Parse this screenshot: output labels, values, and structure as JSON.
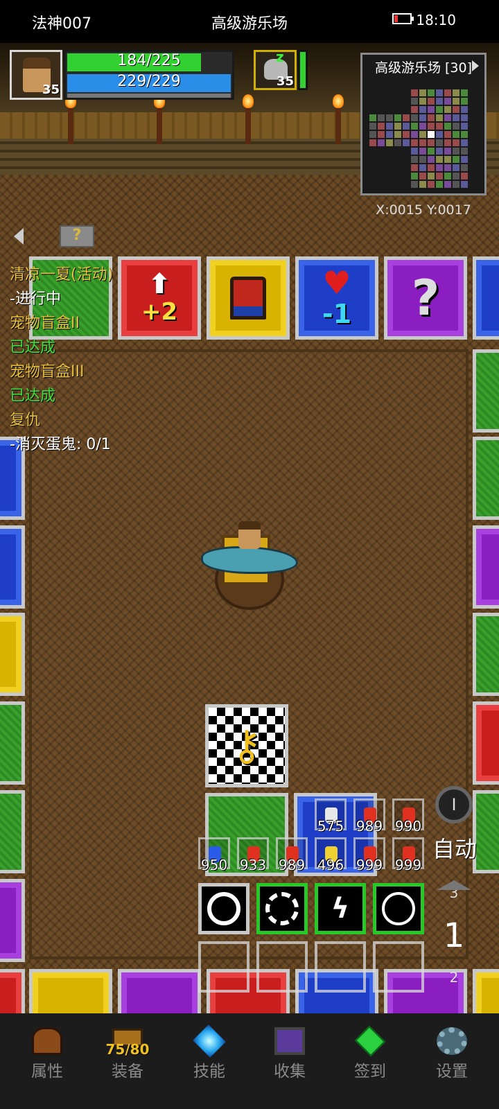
{
  "statusbar": {
    "player_name": "法神007",
    "location": "高级游乐场",
    "time": "18:10"
  },
  "hud": {
    "player_level": "35",
    "hp_text": "184/225",
    "hp_fraction": 0.818,
    "mp_text": "229/229",
    "mp_fraction": 1.0,
    "pet_level": "35",
    "pet_status": "z"
  },
  "minimap": {
    "title": "高级游乐场 [30]",
    "coords": "X:0015  Y:0017"
  },
  "quests": {
    "help_label": "?",
    "lines": [
      {
        "text": "清凉一夏(活动)",
        "style": "title"
      },
      {
        "text": "-进行中",
        "style": "white"
      },
      {
        "text": "宠物盲盒II",
        "style": "title"
      },
      {
        "text": "已达成",
        "style": "green"
      },
      {
        "text": "宠物盲盒III",
        "style": "title"
      },
      {
        "text": "已达成",
        "style": "green"
      },
      {
        "text": "复仇",
        "style": "title"
      },
      {
        "text": "-消灭蛋鬼: 0/1",
        "style": "white"
      }
    ]
  },
  "tiles": {
    "plus_label": "+2",
    "heart_label": "-1",
    "question_label": "?"
  },
  "items": {
    "row1": [
      "575",
      "989",
      "990"
    ],
    "row2": [
      "950",
      "933",
      "989",
      "496",
      "999",
      "999"
    ]
  },
  "controls": {
    "auto_label": "自动",
    "toggle_label": "I",
    "page_up": "3",
    "page_current": "1",
    "page_down": "2"
  },
  "nav": {
    "attributes": "属性",
    "equipment": "装备",
    "equipment_count": "75/80",
    "skills": "技能",
    "collect": "收集",
    "checkin": "签到",
    "settings": "设置"
  }
}
